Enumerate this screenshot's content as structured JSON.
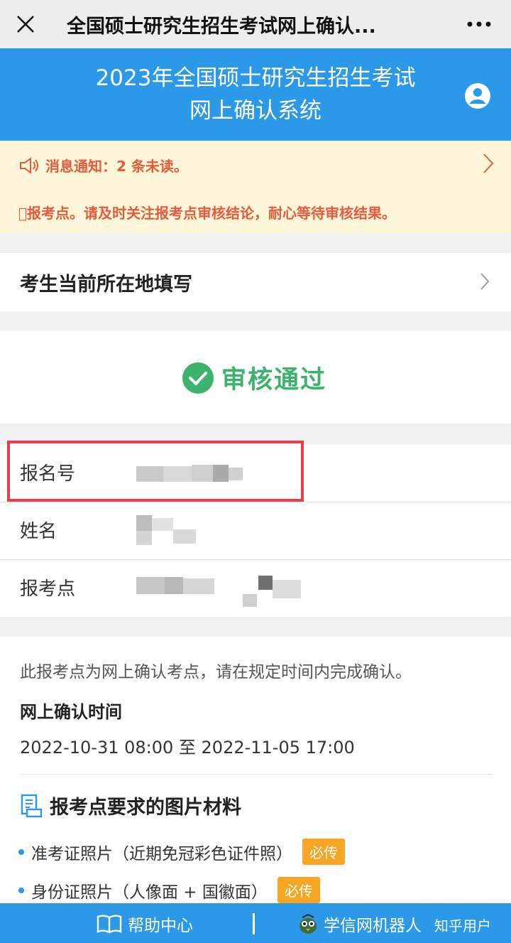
{
  "topbar": {
    "title": "全国硕士研究生招生考试网上确认..."
  },
  "header": {
    "line1": "2023年全国硕士研究生招生考试",
    "line2": "网上确认系统"
  },
  "notice": {
    "title": "消息通知：2 条未读。",
    "detail": "\u0000报考点。请及时关注报考点审核结论，耐心等待审核结果。"
  },
  "location": {
    "label": "考生当前所在地填写"
  },
  "status": {
    "label": "审核通过",
    "color": "#3bb36c"
  },
  "info": {
    "rows": [
      {
        "label": "报名号"
      },
      {
        "label": "姓名"
      },
      {
        "label": "报考点"
      }
    ]
  },
  "details": {
    "description": "此报考点为网上确认考点，请在规定时间内完成确认。",
    "time_heading": "网上确认时间",
    "time_range": "2022-10-31 08:00 至 2022-11-05 17:00",
    "materials_heading": "报考点要求的图片材料",
    "materials": [
      {
        "name": "准考证照片（近期免冠彩色证件照）",
        "badge": "必传"
      },
      {
        "name": "身份证照片（人像面 + 国徽面）",
        "badge": "必传"
      }
    ]
  },
  "footer": {
    "help": "帮助中心",
    "robot": "学信网机器人",
    "watermark": "知乎用户"
  },
  "colors": {
    "accent": "#2c98e8",
    "notice_bg": "#fdf6d8",
    "notice_text": "#e55b3c",
    "highlight_box": "#e53f4e",
    "badge": "#f6a623"
  }
}
